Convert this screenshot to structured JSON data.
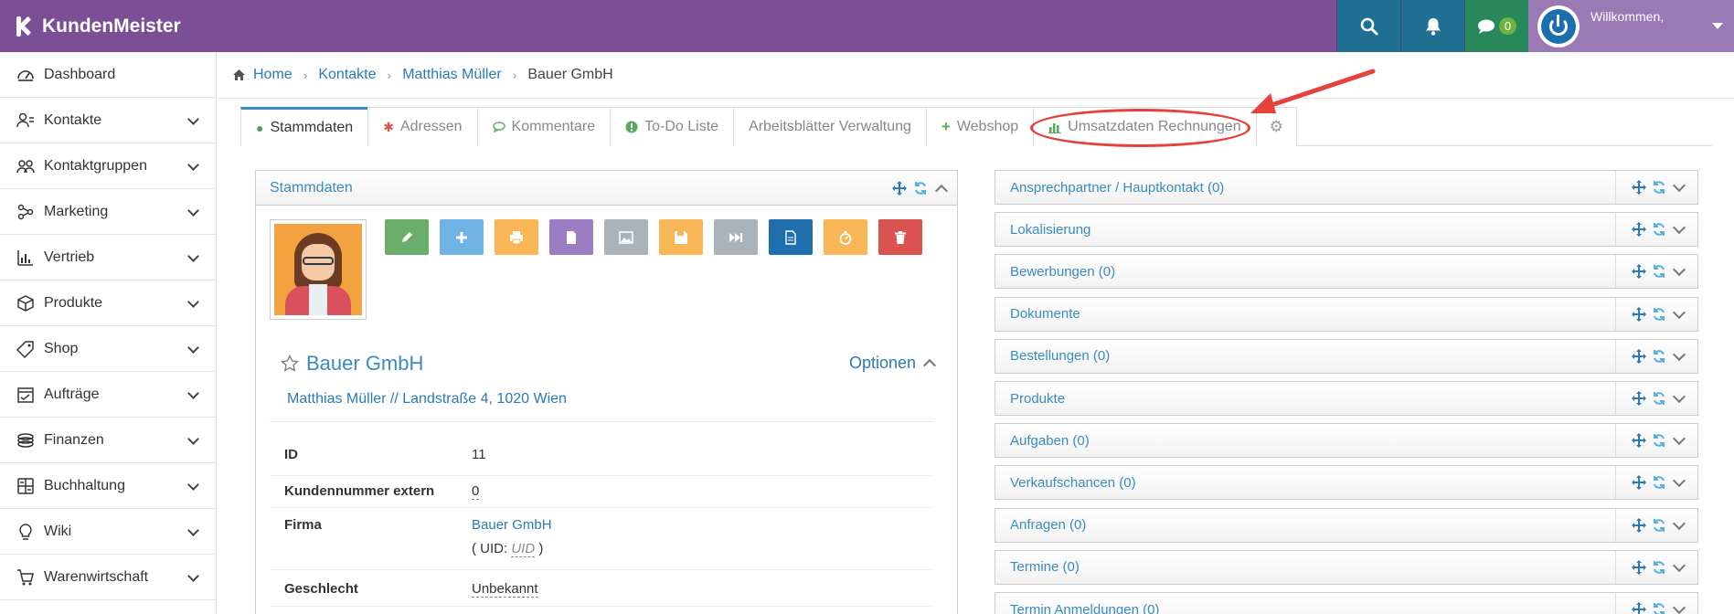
{
  "app": {
    "name": "KundenMeister"
  },
  "header": {
    "chat_count": "0",
    "welcome": "Willkommen,"
  },
  "sidebar": {
    "items": [
      {
        "label": "Dashboard",
        "icon": "dashboard-icon",
        "expandable": false
      },
      {
        "label": "Kontakte",
        "icon": "contacts-icon",
        "expandable": true
      },
      {
        "label": "Kontaktgruppen",
        "icon": "groups-icon",
        "expandable": true
      },
      {
        "label": "Marketing",
        "icon": "marketing-icon",
        "expandable": true
      },
      {
        "label": "Vertrieb",
        "icon": "sales-chart-icon",
        "expandable": true
      },
      {
        "label": "Produkte",
        "icon": "box-icon",
        "expandable": true
      },
      {
        "label": "Shop",
        "icon": "tag-icon",
        "expandable": true
      },
      {
        "label": "Aufträge",
        "icon": "orders-icon",
        "expandable": true
      },
      {
        "label": "Finanzen",
        "icon": "coins-icon",
        "expandable": true
      },
      {
        "label": "Buchhaltung",
        "icon": "calculator-icon",
        "expandable": true
      },
      {
        "label": "Wiki",
        "icon": "lightbulb-icon",
        "expandable": true
      },
      {
        "label": "Warenwirtschaft",
        "icon": "cart-icon",
        "expandable": true
      }
    ]
  },
  "breadcrumb": {
    "home": "Home",
    "contacts": "Kontakte",
    "person": "Matthias Müller",
    "current": "Bauer GmbH"
  },
  "tabs": [
    {
      "label": "Stammdaten",
      "icon": "user-icon",
      "active": true
    },
    {
      "label": "Adressen",
      "icon": "asterisk-icon",
      "active": false
    },
    {
      "label": "Kommentare",
      "icon": "comment-icon",
      "active": false
    },
    {
      "label": "To-Do Liste",
      "icon": "info-icon",
      "active": false
    },
    {
      "label": "Arbeitsblätter Verwaltung",
      "icon": "",
      "active": false
    },
    {
      "label": "Webshop",
      "icon": "plus-icon",
      "active": false
    },
    {
      "label": "Umsatzdaten Rechnungen",
      "icon": "bar-chart-icon",
      "active": false
    },
    {
      "label": "",
      "icon": "gear-icon",
      "active": false
    }
  ],
  "stammdaten": {
    "title": "Stammdaten",
    "company": "Bauer GmbH",
    "options_label": "Optionen",
    "address": "Matthias Müller // Landstraße 4, 1020 Wien",
    "fields": {
      "id": {
        "label": "ID",
        "value": "11"
      },
      "ext_no": {
        "label": "Kundennummer extern",
        "value": "0"
      },
      "firma": {
        "label": "Firma",
        "value": "Bauer GmbH",
        "uid_prefix": "( UID:",
        "uid_placeholder": "UID",
        "uid_suffix": ")"
      },
      "gender": {
        "label": "Geschlecht",
        "value": "Unbekannt"
      }
    },
    "actions": [
      {
        "name": "edit",
        "color": "#6aac6a"
      },
      {
        "name": "add",
        "color": "#6eb3e4"
      },
      {
        "name": "print",
        "color": "#f8b656"
      },
      {
        "name": "document",
        "color": "#9b7ec1"
      },
      {
        "name": "image",
        "color": "#a9b3bb"
      },
      {
        "name": "save",
        "color": "#f8b656"
      },
      {
        "name": "forward",
        "color": "#a9b3bb"
      },
      {
        "name": "file-text",
        "color": "#1f6ead"
      },
      {
        "name": "timer",
        "color": "#f8b656"
      },
      {
        "name": "delete",
        "color": "#d9534f"
      }
    ]
  },
  "panels": [
    "Ansprechpartner / Hauptkontakt (0)",
    "Lokalisierung",
    "Bewerbungen (0)",
    "Dokumente",
    "Bestellungen (0)",
    "Produkte",
    "Aufgaben (0)",
    "Verkaufschancen (0)",
    "Anfragen (0)",
    "Termine (0)",
    "Termin Anmeldungen (0)"
  ],
  "colors": {
    "header": "#7a4f95",
    "accent_link": "#2a7ab8",
    "annotation": "#e8403c"
  }
}
